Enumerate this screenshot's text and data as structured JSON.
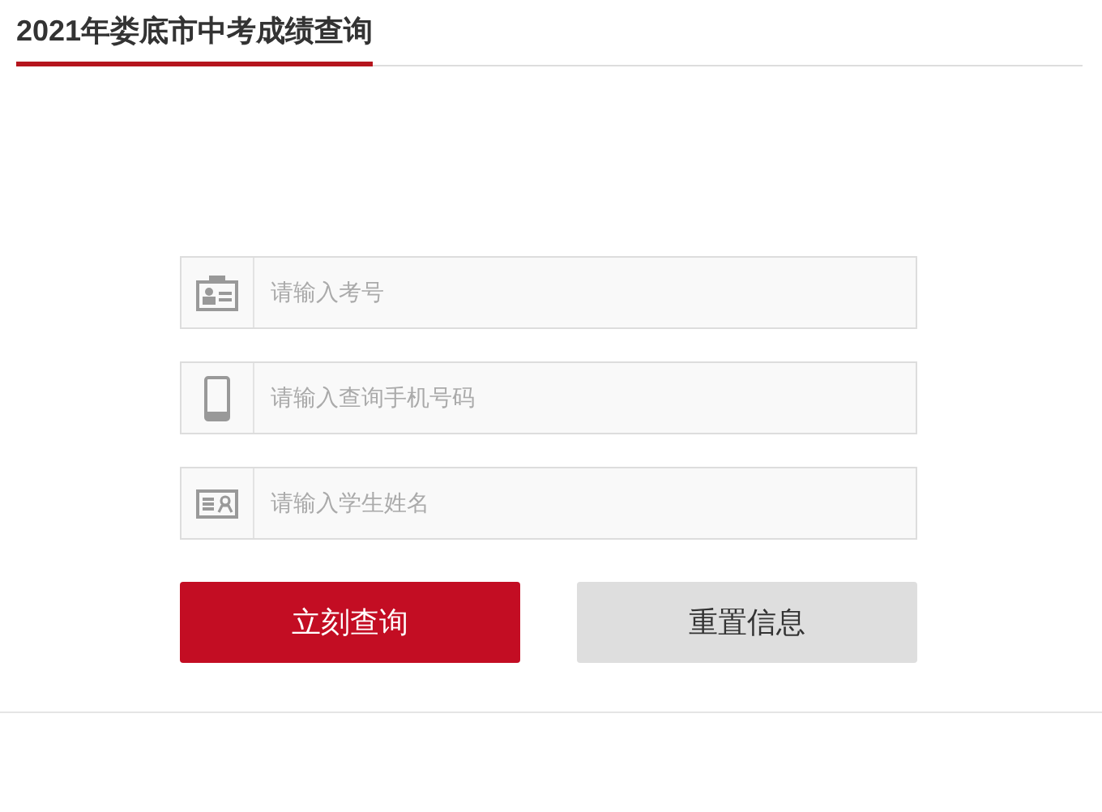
{
  "title": "2021年娄底市中考成绩查询",
  "fields": [
    {
      "kind": "badge",
      "placeholder": "请输入考号"
    },
    {
      "kind": "phone",
      "placeholder": "请输入查询手机号码"
    },
    {
      "kind": "card",
      "placeholder": "请输入学生姓名"
    }
  ],
  "buttons": [
    {
      "kind": "primary",
      "label": "立刻查询"
    },
    {
      "kind": "secondary",
      "label": "重置信息"
    }
  ]
}
